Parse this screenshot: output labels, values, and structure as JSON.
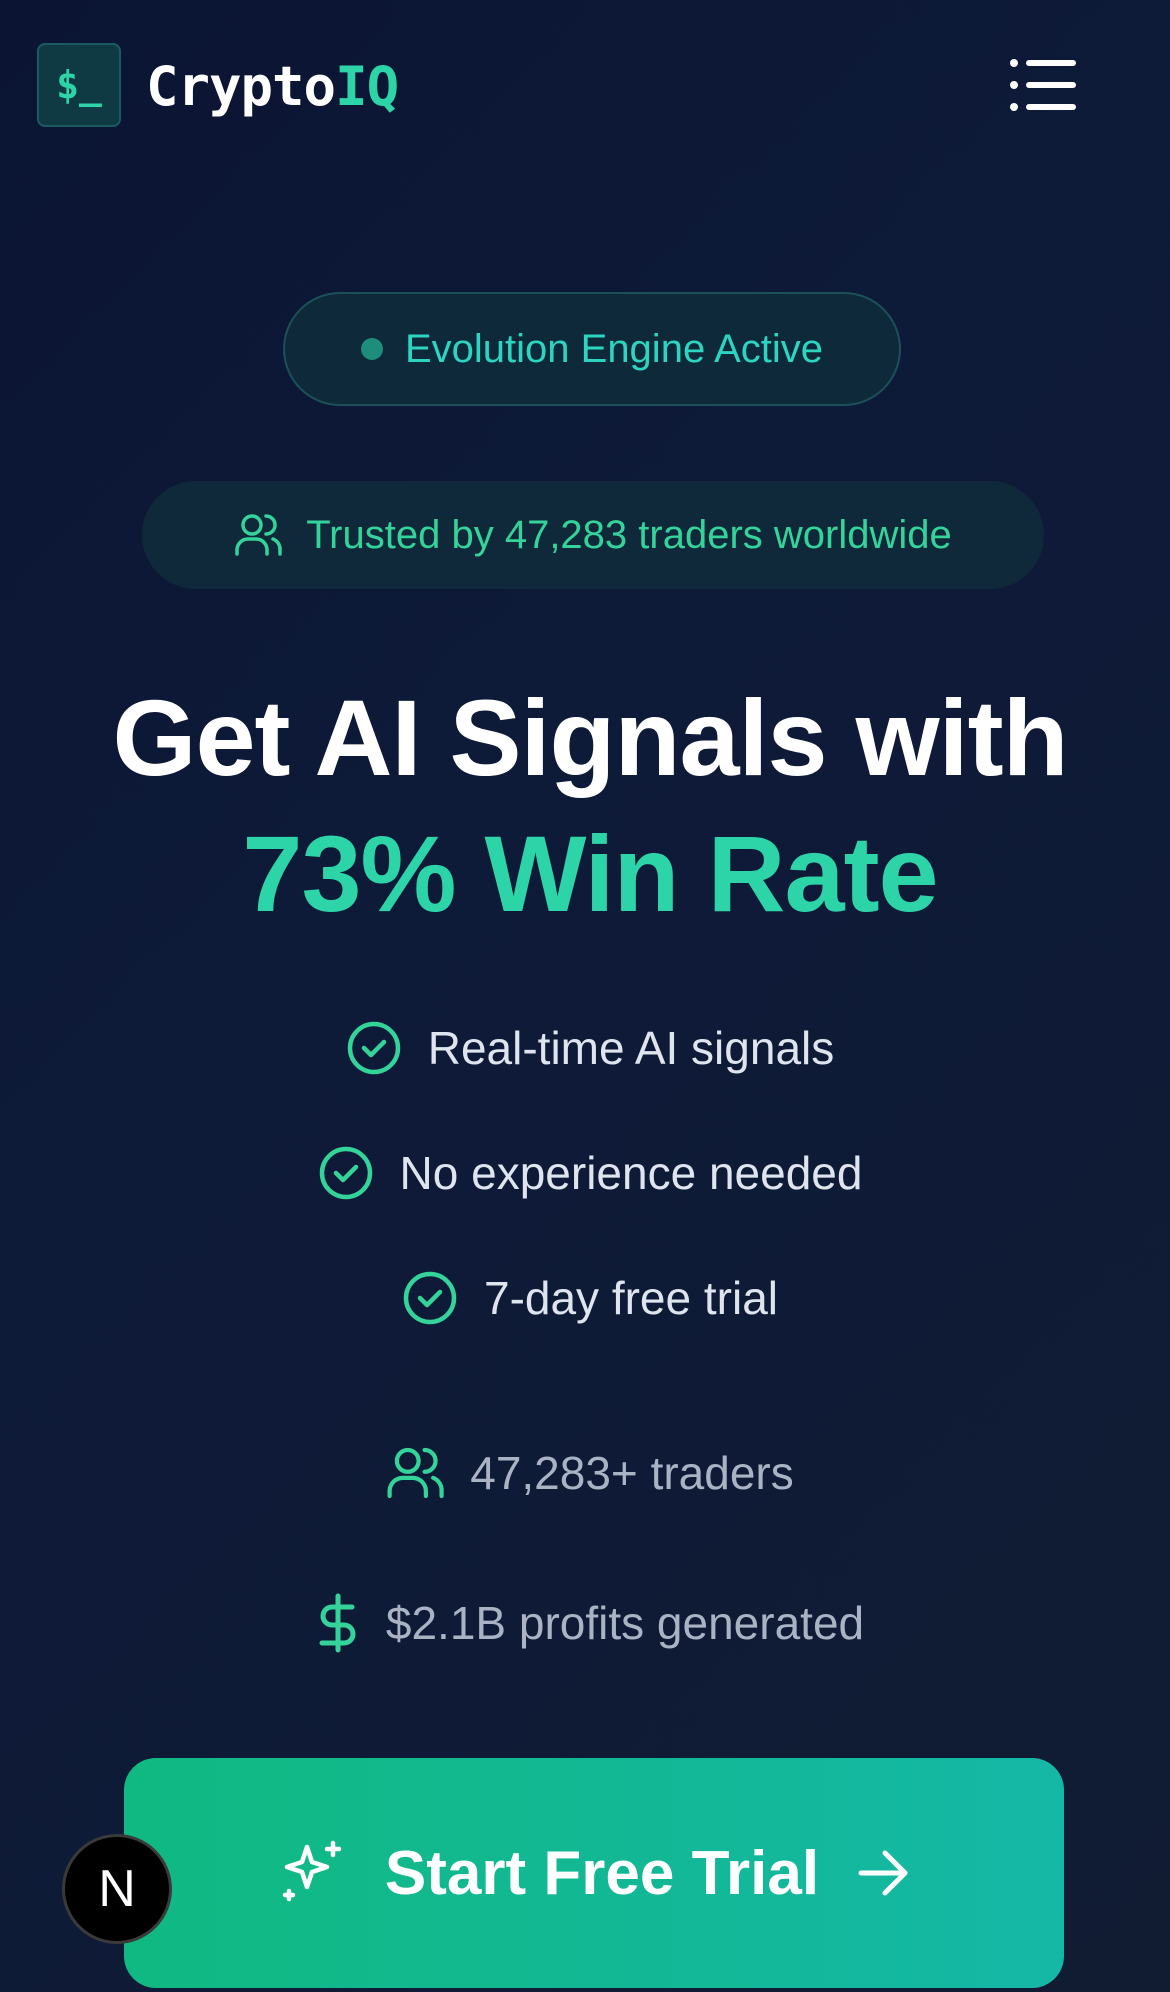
{
  "header": {
    "logo_symbol": "$_",
    "brand_main": "Crypto",
    "brand_accent": "IQ",
    "menu_icon": "menu-icon"
  },
  "status_badge": {
    "label": "Evolution Engine Active"
  },
  "trust_badge": {
    "label": "Trusted by 47,283 traders worldwide",
    "icon": "users-icon"
  },
  "headline": {
    "line1": "Get AI Signals with",
    "line2": "73% Win Rate"
  },
  "features": [
    {
      "label": "Real-time AI signals",
      "icon": "check-circle-icon"
    },
    {
      "label": "No experience needed",
      "icon": "check-circle-icon"
    },
    {
      "label": "7-day free trial",
      "icon": "check-circle-icon"
    }
  ],
  "stats": [
    {
      "label": "47,283+ traders",
      "icon": "users-icon"
    },
    {
      "label": "$2.1B profits generated",
      "icon": "dollar-icon"
    }
  ],
  "cta": {
    "label": "Start Free Trial",
    "left_icon": "sparkles-icon",
    "right_icon": "arrow-right-icon"
  },
  "dev_badge": {
    "label": "N"
  },
  "colors": {
    "accent": "#2dd4a7",
    "background": "#0b1533",
    "cta_start": "#10b981",
    "cta_end": "#14b8a6"
  }
}
